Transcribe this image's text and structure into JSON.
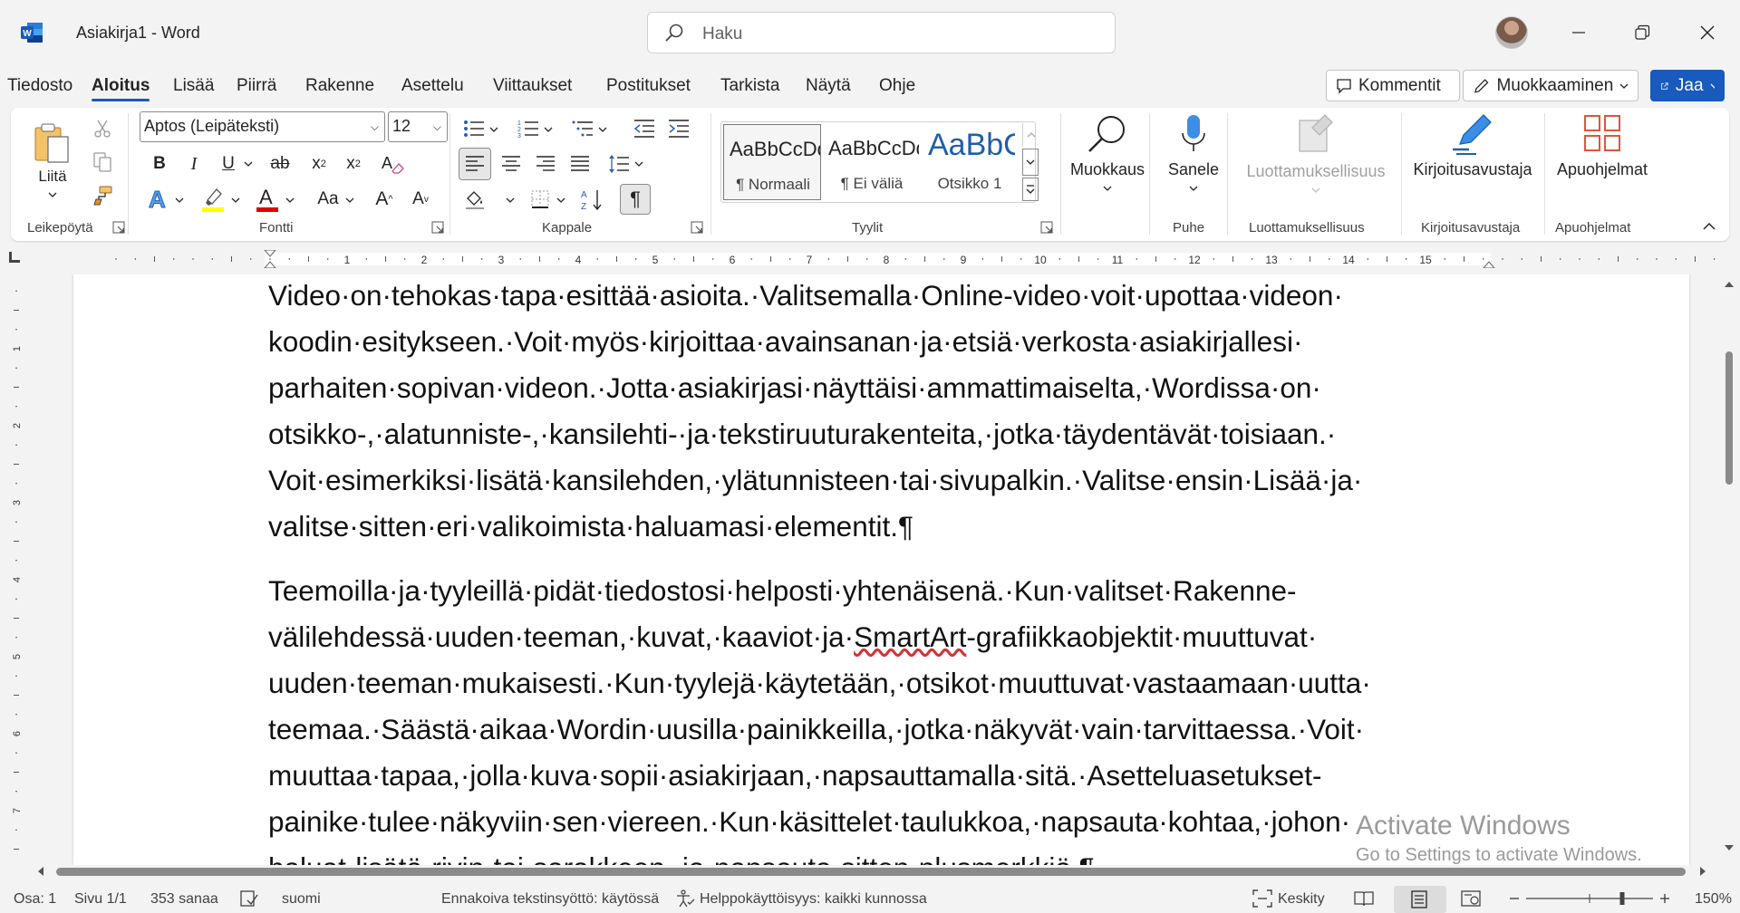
{
  "window": {
    "title": "Asiakirja1  -  Word",
    "search_placeholder": "Haku"
  },
  "menu": {
    "tabs": [
      "Tiedosto",
      "Aloitus",
      "Lisää",
      "Piirrä",
      "Rakenne",
      "Asettelu",
      "Viittaukset",
      "Postitukset",
      "Tarkista",
      "Näytä",
      "Ohje"
    ],
    "active": "Aloitus",
    "comments_label": "Kommentit",
    "editing_label": "Muokkaaminen",
    "share_label": "Jaa"
  },
  "ribbon": {
    "clipboard": {
      "paste_label": "Liitä",
      "group_label": "Leikepöytä"
    },
    "font": {
      "font_name": "Aptos (Leipäteksti)",
      "font_size": "12",
      "group_label": "Fontti",
      "change_case": "Aa",
      "grow": "A",
      "shrink": "A"
    },
    "paragraph": {
      "group_label": "Kappale"
    },
    "styles": {
      "group_label": "Tyylit",
      "items": [
        {
          "preview": "AaBbCcDd",
          "name": "¶ Normaali"
        },
        {
          "preview": "AaBbCcDd",
          "name": "¶ Ei väliä"
        },
        {
          "preview": "AaBbCc",
          "name": "Otsikko 1"
        }
      ]
    },
    "editing": {
      "label": "Muokkaus"
    },
    "voice": {
      "label": "Sanele",
      "group_label": "Puhe"
    },
    "sensitivity": {
      "label": "Luottamuksellisuus",
      "group_label": "Luottamuksellisuus"
    },
    "editor": {
      "label": "Kirjoitusavustaja",
      "group_label": "Kirjoitusavustaja"
    },
    "addins": {
      "label": "Apuohjelmat",
      "group_label": "Apuohjelmat"
    }
  },
  "ruler": {
    "numbers": [
      "1",
      "2",
      "3",
      "4",
      "5",
      "6",
      "7",
      "8",
      "9",
      "10",
      "11",
      "12",
      "13",
      "14",
      "15"
    ],
    "vnumbers": [
      "1",
      "2",
      "3",
      "4",
      "5",
      "6",
      "7"
    ]
  },
  "document": {
    "paragraph1": [
      "Video·on·tehokas·tapa·esittää·asioita.·Valitsemalla·Online-video·voit·upottaa·videon·",
      "koodin·esitykseen.·Voit·myös·kirjoittaa·avainsanan·ja·etsiä·verkosta·asiakirjallesi·",
      "parhaiten·sopivan·videon.·Jotta·asiakirjasi·näyttäisi·ammattimaiselta,·Wordissa·on·",
      "otsikko-,·alatunniste-,·kansilehti-·ja·tekstiruuturakenteita,·jotka·täydentävät·toisiaan.·",
      "Voit·esimerkiksi·lisätä·kansilehden,·ylätunnisteen·tai·sivupalkin.·Valitse·ensin·Lisää·ja·",
      "valitse·sitten·eri·valikoimista·haluamasi·elementit.¶"
    ],
    "paragraph2": [
      "Teemoilla·ja·tyyleillä·pidät·tiedostosi·helposti·yhtenäisenä.·Kun·valitset·Rakenne-",
      "välilehdessä·uuden·teeman,·kuvat,·kaaviot·ja·SmartArt-grafiikkaobjektit·muuttuvat·",
      "uuden·teeman·mukaisesti.·Kun·tyylejä·käytetään,·otsikot·muuttuvat·vastaamaan·uutta·",
      "teemaa.·Säästä·aikaa·Wordin·uusilla·painikkeilla,·jotka·näkyvät·vain·tarvittaessa.·Voit·",
      "muuttaa·tapaa,·jolla·kuva·sopii·asiakirjaan,·napsauttamalla·sitä.·Asetteluasetukset-",
      "painike·tulee·näkyviin·sen·viereen.·Kun·käsittelet·taulukkoa,·napsauta·kohtaa,·johon·",
      "haluat·lisätä·rivin·tai·sarakkeen,·ja·napsauta·sitten·plusmerkkiä.¶"
    ],
    "watermark_title": "Activate Windows",
    "watermark_sub": "Go to Settings to activate Windows."
  },
  "status": {
    "section": "Osa: 1",
    "page": "Sivu 1/1",
    "words": "353 sanaa",
    "language": "suomi",
    "predictive": "Ennakoiva tekstinsyöttö: käytössä",
    "accessibility": "Helppokäyttöisyys: kaikki kunnossa",
    "focus": "Keskity",
    "zoom": "150%",
    "zoom_fraction": 0.5
  },
  "colors": {
    "accent": "#185abd",
    "font_color": "#e00000",
    "highlight": "#ffff00"
  }
}
